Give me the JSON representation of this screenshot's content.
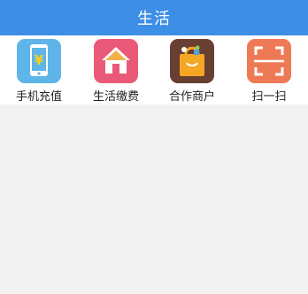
{
  "header": {
    "title": "生活"
  },
  "services": [
    {
      "label": "手机充值",
      "icon": "phone-recharge-icon",
      "color": "#5fb4ea"
    },
    {
      "label": "生活缴费",
      "icon": "home-icon",
      "color": "#ea5a78"
    },
    {
      "label": "合作商户",
      "icon": "shopping-bag-icon",
      "color": "#6a3f33"
    },
    {
      "label": "扫一扫",
      "icon": "scan-icon",
      "color": "#ee7a55"
    }
  ],
  "icon_glyphs": {
    "currency": "¥"
  },
  "colors": {
    "header": "#3d8fe5",
    "background": "#f2f2f2"
  }
}
